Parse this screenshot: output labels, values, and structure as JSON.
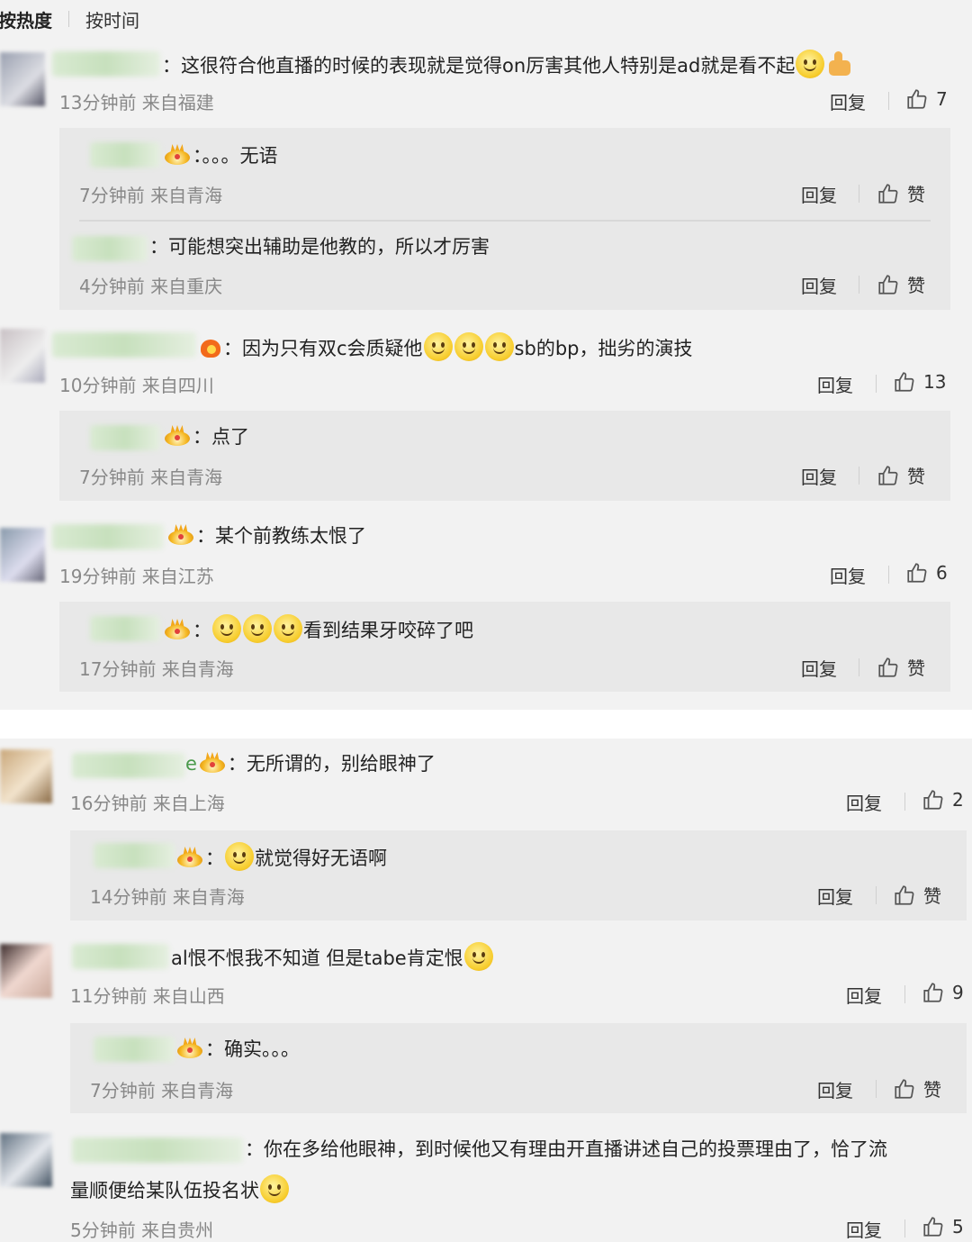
{
  "sort": {
    "hot": "按热度",
    "time": "按时间"
  },
  "thumb_color": "#555555",
  "comments": [
    {
      "text": "：这很符合他直播的时候的表现就是觉得on厉害其他人特别是ad就是看不起",
      "meta": "13分钟前 来自福建",
      "reply": "回复",
      "likes": "7",
      "replies": [
        {
          "text": "：。。。无语",
          "meta": "7分钟前 来自青海",
          "reply": "回复",
          "likes": "赞"
        },
        {
          "text": "：可能想突出辅助是他教的，所以才厉害",
          "meta": "4分钟前 来自重庆",
          "reply": "回复",
          "likes": "赞"
        }
      ]
    },
    {
      "text_a": "：因为只有双c会质疑他",
      "text_b": "sb的bp，拙劣的演技",
      "meta": "10分钟前 来自四川",
      "reply": "回复",
      "likes": "13",
      "replies": [
        {
          "text": "：点了",
          "meta": "7分钟前 来自青海",
          "reply": "回复",
          "likes": "赞"
        }
      ]
    },
    {
      "text": "：某个前教练太恨了",
      "meta": "19分钟前 来自江苏",
      "reply": "回复",
      "likes": "6",
      "replies": [
        {
          "text_a": "：",
          "text_b": "看到结果牙咬碎了吧",
          "meta": "17分钟前 来自青海",
          "reply": "回复",
          "likes": "赞"
        }
      ]
    },
    {
      "name_tail": "e",
      "text": "：无所谓的，别给眼神了",
      "meta": "16分钟前 来自上海",
      "reply": "回复",
      "likes": "2",
      "replies": [
        {
          "text_a": "：",
          "text_b": "就觉得好无语啊",
          "meta": "14分钟前 来自青海",
          "reply": "回复",
          "likes": "赞"
        }
      ]
    },
    {
      "text": "al恨不恨我不知道 但是tabe肯定恨",
      "meta": "11分钟前 来自山西",
      "reply": "回复",
      "likes": "9",
      "replies": [
        {
          "text": "：确实。。。",
          "meta": "7分钟前 来自青海",
          "reply": "回复",
          "likes": "赞"
        }
      ]
    },
    {
      "text_line1": "：你在多给他眼神，到时候他又有理由开直播讲述自己的投票理由了，恰了流",
      "text_line2": "量顺便给某队伍投名状",
      "meta": "5分钟前 来自贵州",
      "reply": "回复",
      "likes": "5",
      "replies": []
    }
  ]
}
